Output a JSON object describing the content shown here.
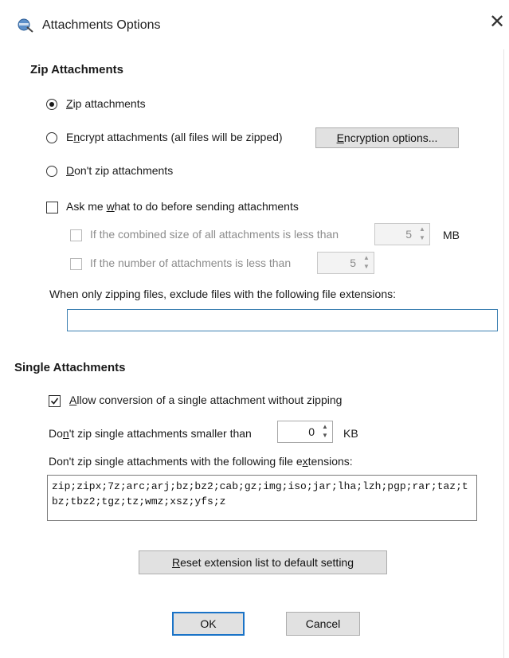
{
  "window": {
    "title": "Attachments Options",
    "close_glyph": "✕"
  },
  "zip_section": {
    "heading": "Zip Attachments",
    "radios": [
      {
        "pre": "",
        "u": "Z",
        "post": "ip attachments",
        "checked": true
      },
      {
        "pre": "E",
        "u": "n",
        "post": "crypt attachments (all files will be zipped)",
        "checked": false
      },
      {
        "pre": "",
        "u": "D",
        "post": "on't zip attachments",
        "checked": false
      }
    ],
    "encryption_button": {
      "pre": "",
      "u": "E",
      "post": "ncryption options..."
    },
    "ask_checkbox": {
      "pre": "Ask me ",
      "u": "w",
      "post": "hat to do before sending attachments",
      "checked": false
    },
    "size_condition": {
      "label": "If the combined size of all attachments is less than",
      "value": "5",
      "unit": "MB"
    },
    "count_condition": {
      "label": "If the number of attachments is less than",
      "value": "5"
    },
    "exclude_label": "When only zipping files, exclude files with the following file extensions:",
    "exclude_value": ""
  },
  "single_section": {
    "heading": "Single Attachments",
    "allow_checkbox": {
      "pre": "",
      "u": "A",
      "post": "llow conversion of a single attachment without zipping",
      "checked": true
    },
    "smaller_than": {
      "pre": "Do",
      "u": "n",
      "post": "'t zip single attachments smaller than",
      "value": "0",
      "unit": "KB"
    },
    "extensions_label": {
      "pre": "Don't zip single attachments with the following file e",
      "u": "x",
      "post": "tensions:"
    },
    "extensions_value": "zip;zipx;7z;arc;arj;bz;bz2;cab;gz;img;iso;jar;lha;lzh;pgp;rar;taz;tbz;tbz2;tgz;tz;wmz;xsz;yfs;z",
    "reset_button": {
      "pre": "",
      "u": "R",
      "post": "eset extension list to default setting"
    }
  },
  "footer": {
    "ok_label": "OK",
    "cancel_label": "Cancel"
  },
  "colors": {
    "accent": "#1a73c7",
    "button_face": "#e1e1e1"
  },
  "icons": {
    "app": "attachment-options-icon",
    "close": "close-icon",
    "spin": "spin-arrows-icon",
    "tick": "checkmark-icon"
  }
}
